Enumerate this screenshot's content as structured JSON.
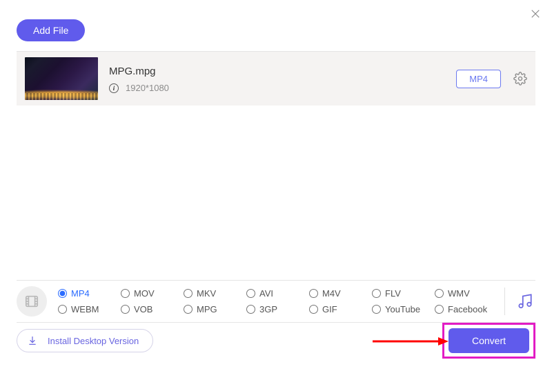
{
  "header": {
    "add_file_label": "Add File"
  },
  "file": {
    "name": "MPG.mpg",
    "resolution": "1920*1080",
    "output_format": "MP4"
  },
  "formats": {
    "selected": "MP4",
    "row1": [
      "MP4",
      "MOV",
      "MKV",
      "AVI",
      "M4V",
      "FLV",
      "WMV"
    ],
    "row2": [
      "WEBM",
      "VOB",
      "MPG",
      "3GP",
      "GIF",
      "YouTube",
      "Facebook"
    ]
  },
  "footer": {
    "install_label": "Install Desktop Version",
    "convert_label": "Convert"
  }
}
